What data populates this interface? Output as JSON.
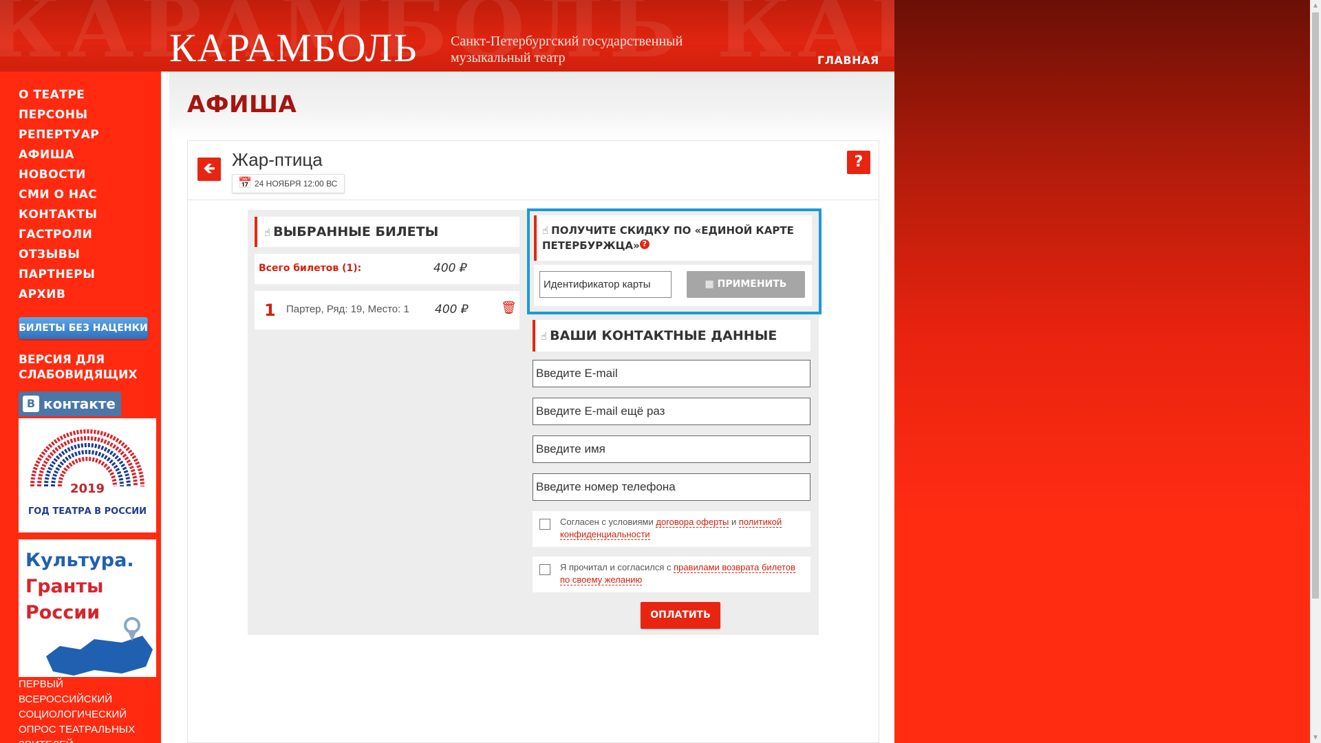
{
  "header": {
    "logo": "КАРАМБОЛЬ",
    "subtitle": "Санкт-Петербургский государственный музыкальный театр",
    "nav_home": "ГЛАВНАЯ"
  },
  "sidebar": {
    "menu": [
      "О ТЕАТРЕ",
      "ПЕРСОНЫ",
      "РЕПЕРТУАР",
      "АФИША",
      "НОВОСТИ",
      "СМИ О НАС",
      "КОНТАКТЫ",
      "ГАСТРОЛИ",
      "ОТЗЫВЫ",
      "ПАРТНЕРЫ",
      "АРХИВ"
    ],
    "tickets_button": "БИЛЕТЫ БЕЗ НАЦЕНКИ",
    "vision_link": "ВЕРСИЯ ДЛЯ СЛАБОВИДЯЩИХ",
    "vk_label": "контакте",
    "vk_letter": "В",
    "banner_theatre": {
      "year": "2019",
      "caption": "ГОД ТЕАТРА В РОССИИ"
    },
    "banner_culture": {
      "line1": "Культура.",
      "line2": "Гранты",
      "line3": "России"
    },
    "survey_text": "ПЕРВЫЙ ВСЕРОССИЙСКИЙ СОЦИОЛОГИЧЕСКИЙ ОПРОС ТЕАТРАЛЬНЫХ ЗРИТЕЛЕЙ"
  },
  "page": {
    "title": "АФИША",
    "show_title": "Жар-птица",
    "date": "24 НОЯБРЯ 12:00 ВС",
    "help": "?"
  },
  "tickets": {
    "heading": "ВЫБРАННЫЕ БИЛЕТЫ",
    "total_label": "Всего билетов (1):",
    "total_price": "400 ₽",
    "items": [
      {
        "num": "1",
        "seat": "Партер, Ряд: 19, Место: 1",
        "price": "400 ₽"
      }
    ]
  },
  "discount": {
    "heading": "ПОЛУЧИТЕ СКИДКУ ПО «ЕДИНОЙ КАРТЕ ПЕТЕРБУРЖЦА»",
    "input_placeholder": "Идентификатор карты",
    "apply_label": "ПРИМЕНИТЬ"
  },
  "contacts": {
    "heading": "ВАШИ КОНТАКТНЫЕ ДАННЫЕ",
    "email_placeholder": "Введите E-mail",
    "email2_placeholder": "Введите E-mail ещё раз",
    "name_placeholder": "Введите имя",
    "phone_placeholder": "Введите номер телефона",
    "agree1_prefix": "Согласен с условиями ",
    "agree1_link1": "договора оферты",
    "agree1_mid": " и ",
    "agree1_link2": "политикой конфиденциальности",
    "agree2_prefix": "Я прочитал и согласился с ",
    "agree2_link": "правилами возврата билетов по своему желанию",
    "pay_label": "ОПЛАТИТЬ"
  },
  "colors": {
    "accent": "#e82511",
    "title": "#a5150f",
    "highlight_border": "#1a9ad8"
  }
}
